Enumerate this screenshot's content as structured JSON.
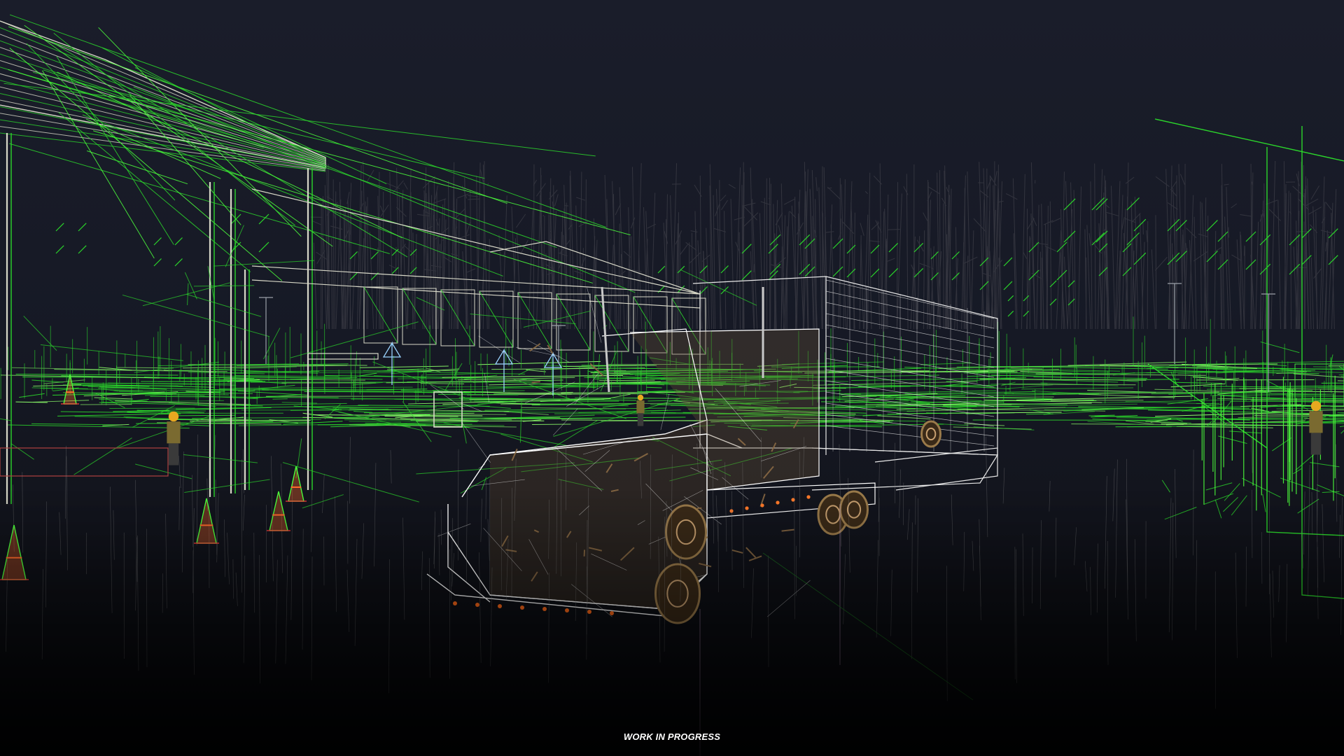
{
  "viewport": {
    "label": "WORK IN PROGRESS"
  },
  "scene": {
    "render_mode": "wireframe",
    "colors": {
      "background": "#191c28",
      "ground_fade": "#050608",
      "wire_static": "#2bd62b",
      "wire_bright": "#4cff3c",
      "wire_white": "#e6e6e6",
      "truck_body": "#6a5438",
      "cone": "#ff6a2a",
      "worker": "#e0a020"
    },
    "objects": [
      "warehouse-canopy",
      "left-building",
      "semi-truck",
      "trailer",
      "tree-line",
      "light-poles",
      "traffic-cones",
      "workers",
      "right-building"
    ]
  }
}
